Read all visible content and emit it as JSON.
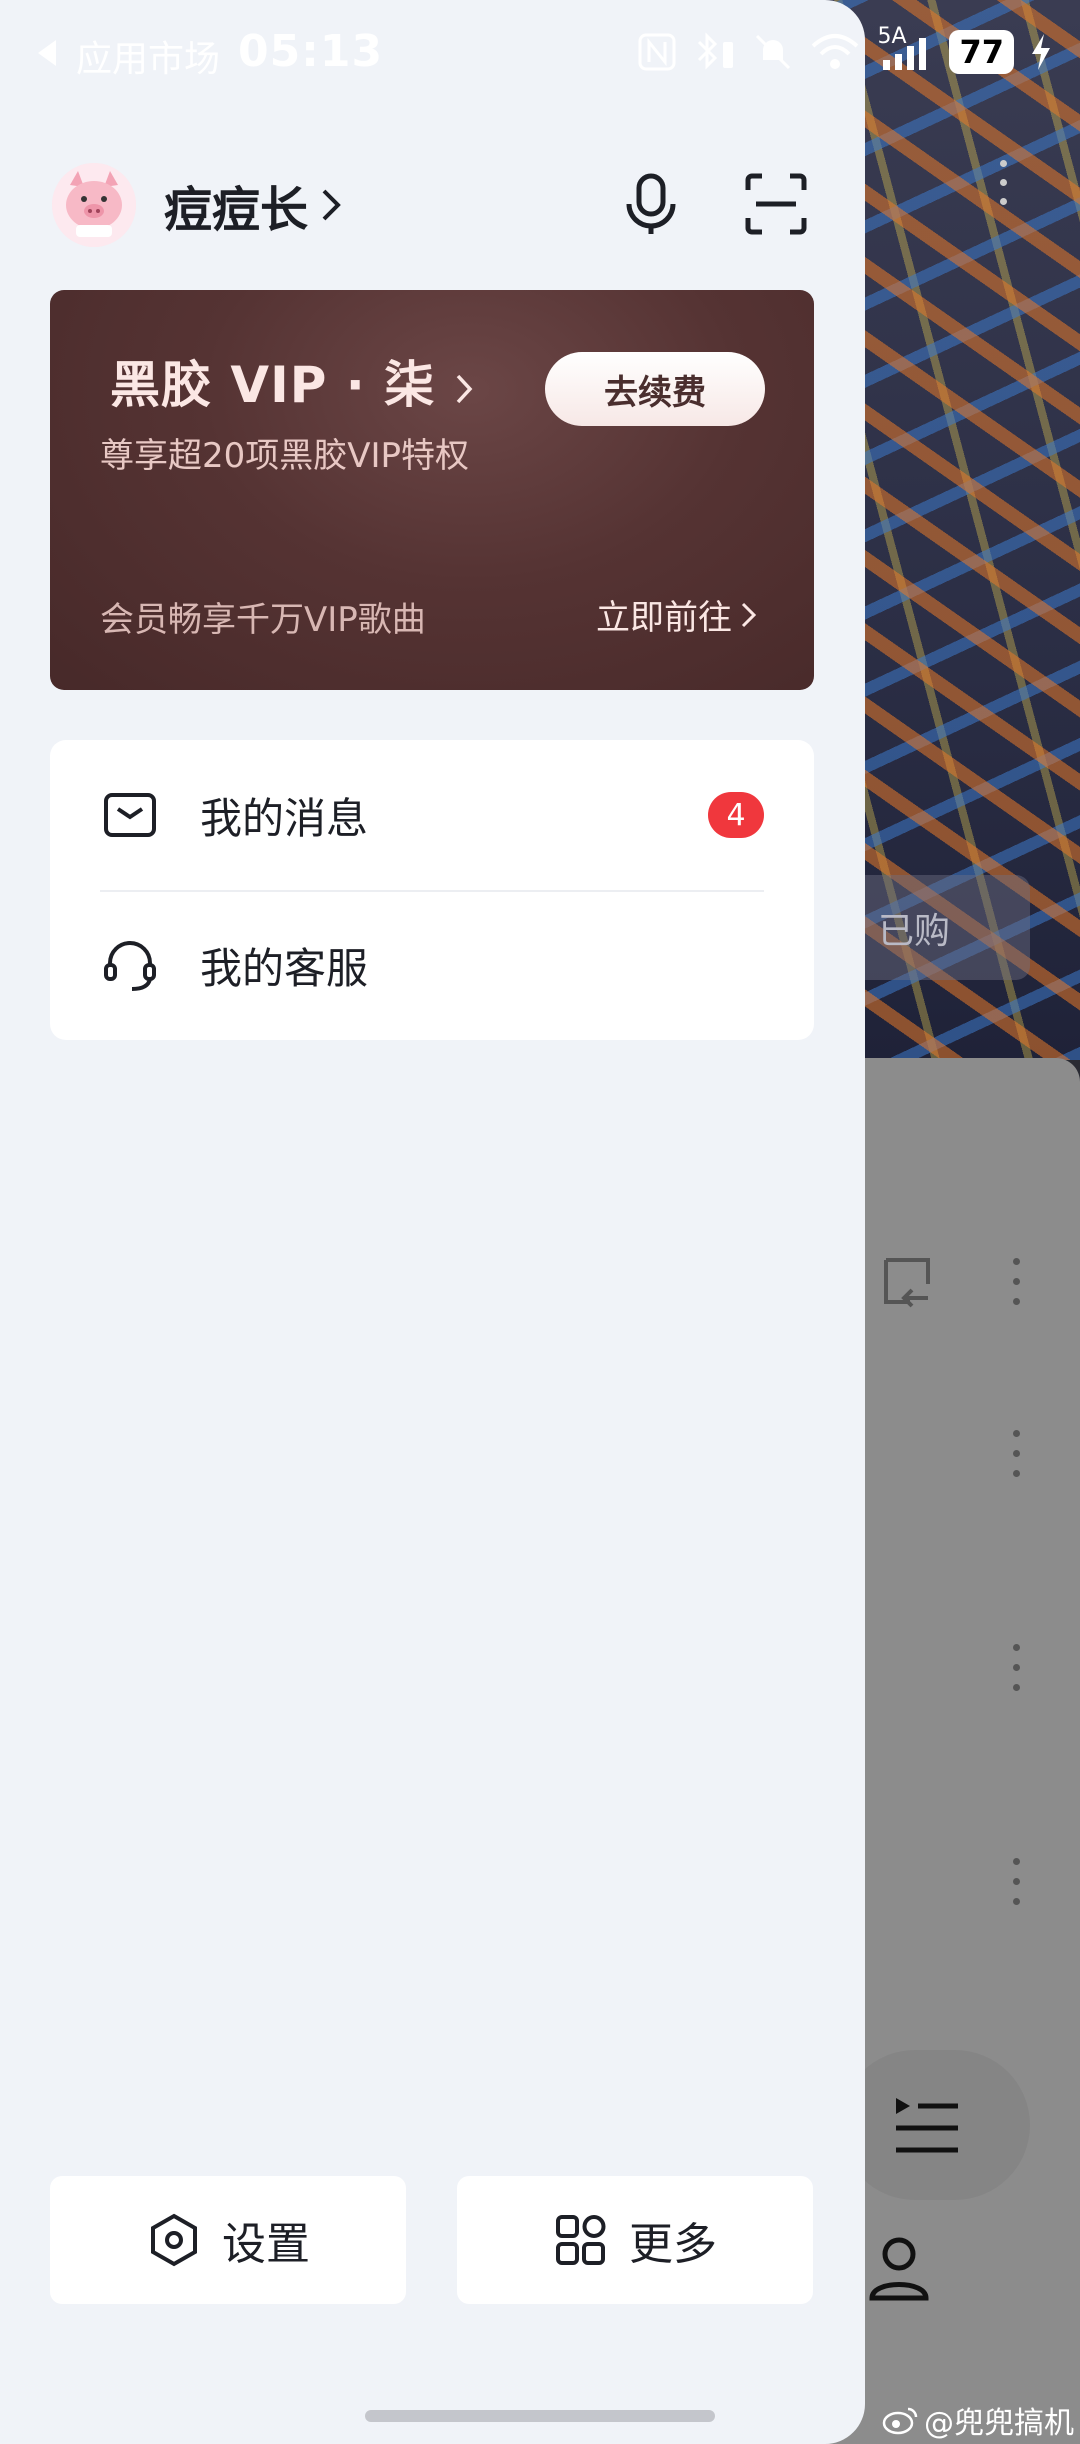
{
  "status_bar": {
    "back_app": "应用市场",
    "time": "05:13",
    "network": "5A",
    "battery": "77"
  },
  "profile": {
    "username": "痘痘长"
  },
  "vip": {
    "title": "黑胶 VIP · 柒",
    "subtitle": "尊享超20项黑胶VIP特权",
    "renew_label": "去续费",
    "songs_text": "会员畅享千万VIP歌曲",
    "go_label": "立即前往"
  },
  "menu": {
    "items": [
      {
        "label": "我的消息",
        "badge": "4"
      },
      {
        "label": "我的客服"
      }
    ]
  },
  "bottom": {
    "settings_label": "设置",
    "more_label": "更多"
  },
  "background": {
    "purchased_label": "已购"
  },
  "watermark": "@兜兜搞机"
}
